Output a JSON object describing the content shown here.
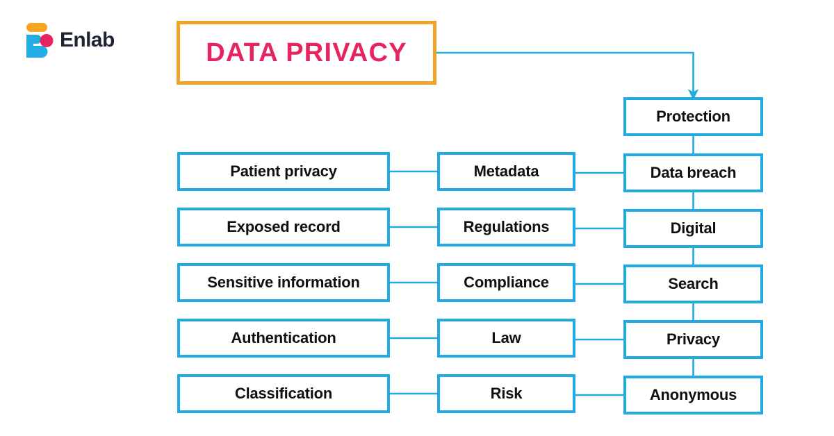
{
  "brand": {
    "name": "Enlab",
    "logo_icon": "enlab-logo-icon",
    "colors": {
      "orange": "#F5A623",
      "cyan": "#22AEE5",
      "pink": "#E6245F",
      "wordmark": "#1C2333"
    }
  },
  "title": {
    "text": "DATA PRIVACY",
    "text_color": "#E6245F",
    "border_color": "#F0A32B"
  },
  "theme": {
    "node_border_color": "#20ACE3",
    "node_text_color": "#101010",
    "connector_color": "#20ACE3",
    "background": "#FFFFFF"
  },
  "diagram": {
    "type": "flow-chart",
    "root": "DATA PRIVACY",
    "columns": {
      "left": {
        "name": "left-column",
        "nodes": [
          {
            "label": "Patient privacy"
          },
          {
            "label": "Exposed record"
          },
          {
            "label": "Sensitive information"
          },
          {
            "label": "Authentication"
          },
          {
            "label": "Classification"
          }
        ]
      },
      "middle": {
        "name": "middle-column",
        "nodes": [
          {
            "label": "Metadata"
          },
          {
            "label": "Regulations"
          },
          {
            "label": "Compliance"
          },
          {
            "label": "Law"
          },
          {
            "label": "Risk"
          }
        ]
      },
      "right": {
        "name": "right-column",
        "nodes": [
          {
            "label": "Protection"
          },
          {
            "label": "Data breach"
          },
          {
            "label": "Digital"
          },
          {
            "label": "Search"
          },
          {
            "label": "Privacy"
          },
          {
            "label": "Anonymous"
          }
        ]
      }
    },
    "connections": [
      {
        "from": "DATA PRIVACY",
        "to": "Protection",
        "kind": "arrow"
      },
      {
        "from": "Protection",
        "to": "Data breach",
        "kind": "line"
      },
      {
        "from": "Data breach",
        "to": "Digital",
        "kind": "line"
      },
      {
        "from": "Digital",
        "to": "Search",
        "kind": "line"
      },
      {
        "from": "Search",
        "to": "Privacy",
        "kind": "line"
      },
      {
        "from": "Privacy",
        "to": "Anonymous",
        "kind": "line"
      },
      {
        "from": "Patient privacy",
        "to": "Metadata",
        "kind": "line"
      },
      {
        "from": "Metadata",
        "to": "Data breach",
        "kind": "line"
      },
      {
        "from": "Exposed record",
        "to": "Regulations",
        "kind": "line"
      },
      {
        "from": "Regulations",
        "to": "Digital",
        "kind": "line"
      },
      {
        "from": "Sensitive information",
        "to": "Compliance",
        "kind": "line"
      },
      {
        "from": "Compliance",
        "to": "Search",
        "kind": "line"
      },
      {
        "from": "Authentication",
        "to": "Law",
        "kind": "line"
      },
      {
        "from": "Law",
        "to": "Privacy",
        "kind": "line"
      },
      {
        "from": "Classification",
        "to": "Risk",
        "kind": "line"
      },
      {
        "from": "Risk",
        "to": "Anonymous",
        "kind": "line"
      }
    ]
  }
}
